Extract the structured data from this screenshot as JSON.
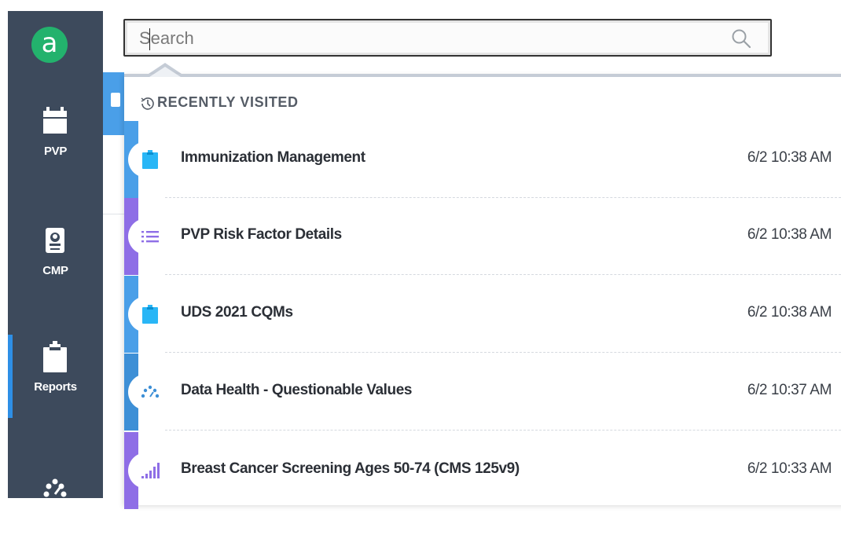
{
  "colors": {
    "sidebar_bg": "#3d4a5c",
    "brand_green": "#23b26d",
    "active_accent": "#2e8fe6",
    "blue_category": "#4a9fe8",
    "purple_category": "#8e6ee6",
    "teal_category": "#3d8fd6"
  },
  "sidebar": {
    "logo_letter": "a",
    "items": [
      {
        "label": "PVP",
        "icon": "calendar-icon"
      },
      {
        "label": "CMP",
        "icon": "id-badge-icon"
      },
      {
        "label": "Reports",
        "icon": "clipboard-icon",
        "active": true
      },
      {
        "label": "",
        "icon": "gauge-icon"
      }
    ]
  },
  "search": {
    "placeholder": "Search",
    "value": "",
    "icon": "search-icon"
  },
  "recent": {
    "header": "RECENTLY VISITED",
    "header_icon": "history-icon",
    "items": [
      {
        "title": "Immunization Management",
        "time": "6/2 10:38 AM",
        "icon": "clipboard-icon",
        "accent": "#4a9fe8"
      },
      {
        "title": "PVP Risk Factor Details",
        "time": "6/2 10:38 AM",
        "icon": "list-icon",
        "accent": "#8e6ee6"
      },
      {
        "title": "UDS 2021 CQMs",
        "time": "6/2 10:38 AM",
        "icon": "clipboard-icon",
        "accent": "#4a9fe8"
      },
      {
        "title": "Data Health - Questionable Values",
        "time": "6/2 10:37 AM",
        "icon": "gauge-icon",
        "accent": "#3d8fd6"
      },
      {
        "title": "Breast Cancer Screening Ages 50-74 (CMS 125v9)",
        "time": "6/2 10:33 AM",
        "icon": "bar-chart-icon",
        "accent": "#8e6ee6"
      }
    ]
  }
}
